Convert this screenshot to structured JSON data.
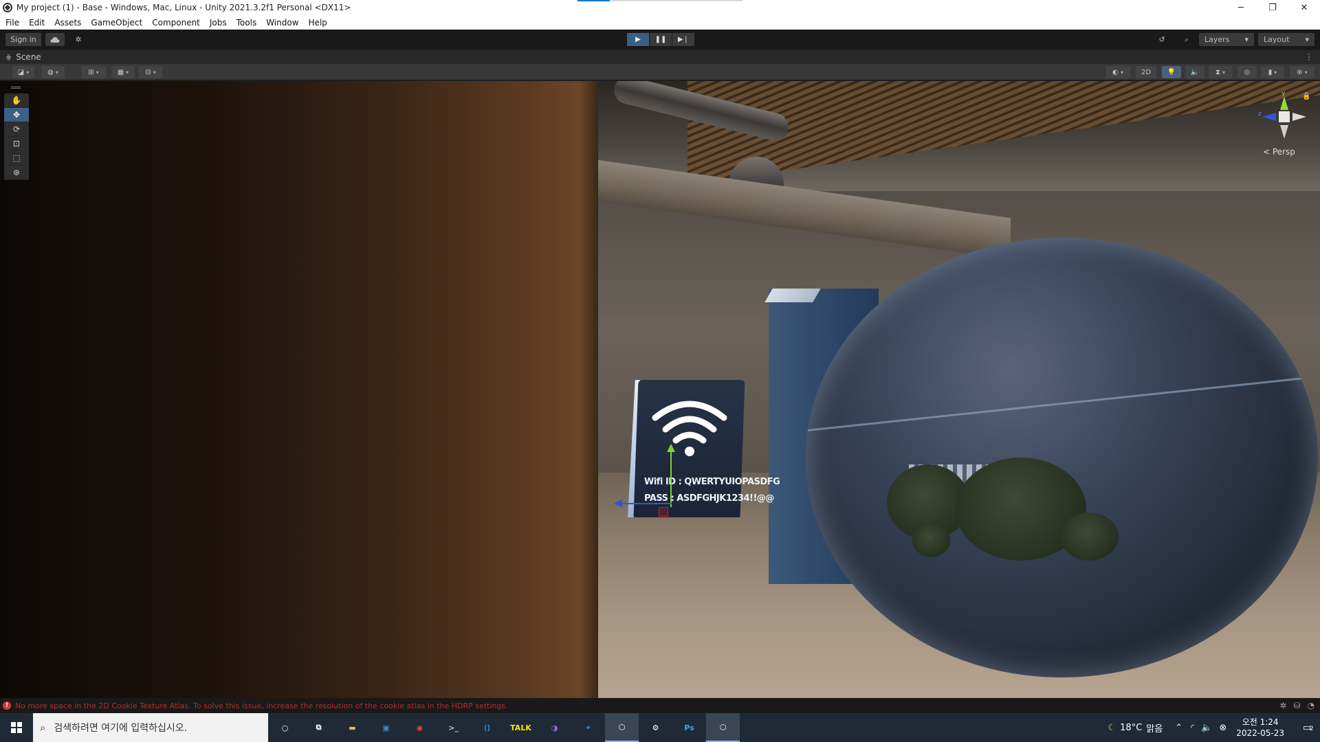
{
  "window": {
    "title": "My project (1) - Base - Windows, Mac, Linux - Unity 2021.3.2f1 Personal <DX11>",
    "controls": [
      "─",
      "❐",
      "✕"
    ]
  },
  "menu": [
    "File",
    "Edit",
    "Assets",
    "GameObject",
    "Component",
    "Jobs",
    "Tools",
    "Window",
    "Help"
  ],
  "toolbar": {
    "sign_in": "Sign in",
    "cloud_icon": "cloud-icon",
    "collab_icon": "collab-icon",
    "play": "▶",
    "pause": "❚❚",
    "step": "▶❘",
    "history_icon": "history-icon",
    "search_icon": "search-icon",
    "layers": "Layers",
    "layout": "Layout"
  },
  "scene_tab": {
    "label": "Scene",
    "menu_glyph": "⋮"
  },
  "scene_toolbar": {
    "btn_2d": "2D"
  },
  "tools": [
    "hand-tool-icon",
    "move-tool-icon",
    "rotate-tool-icon",
    "scale-tool-icon",
    "rect-tool-icon",
    "transform-tool-icon"
  ],
  "gizmo": {
    "y": "y",
    "z": "z",
    "persp": "Persp"
  },
  "sign": {
    "wifi_id": "Wifi ID : QWERTYUIOPASDFG",
    "pass": "PASS : ASDFGHJK1234!!@@"
  },
  "status": {
    "error": "No more space in the 2D Cookie Texture Atlas. To solve this issue, increase the resolution of the cookie atlas in the HDRP settings."
  },
  "taskbar": {
    "search_placeholder": "검색하려면 여기에 입력하십시오.",
    "apps": [
      {
        "name": "cortana-icon",
        "glyph": "○",
        "color": "#ffffff"
      },
      {
        "name": "task-view-icon",
        "glyph": "⧉",
        "color": "#ffffff"
      },
      {
        "name": "file-explorer-icon",
        "glyph": "▬",
        "color": "#f0c040"
      },
      {
        "name": "store-icon",
        "glyph": "▣",
        "color": "#2f8fe0"
      },
      {
        "name": "chrome-icon",
        "glyph": "◉",
        "color": "#e84333"
      },
      {
        "name": "terminal-icon",
        "glyph": ">_",
        "color": "#cccccc"
      },
      {
        "name": "vscode-icon",
        "glyph": "⟨⟩",
        "color": "#1f9cf0"
      },
      {
        "name": "kakaotalk-icon",
        "glyph": "TALK",
        "color": "#f7e600"
      },
      {
        "name": "github-desktop-icon",
        "glyph": "◑",
        "color": "#9b6cf0"
      },
      {
        "name": "sourcetree-icon",
        "glyph": "✦",
        "color": "#2d7df0"
      },
      {
        "name": "unity-hub-icon",
        "glyph": "⬡",
        "color": "#ffffff"
      },
      {
        "name": "settings-icon",
        "glyph": "⚙",
        "color": "#ffffff"
      },
      {
        "name": "photoshop-icon",
        "glyph": "Ps",
        "color": "#31a8ff"
      },
      {
        "name": "unity-icon",
        "glyph": "⬡",
        "color": "#ffffff"
      }
    ],
    "weather_temp": "18°C",
    "weather_text": "맑음",
    "time": "오전 1:24",
    "date": "2022-05-23",
    "notif_count": "2"
  }
}
